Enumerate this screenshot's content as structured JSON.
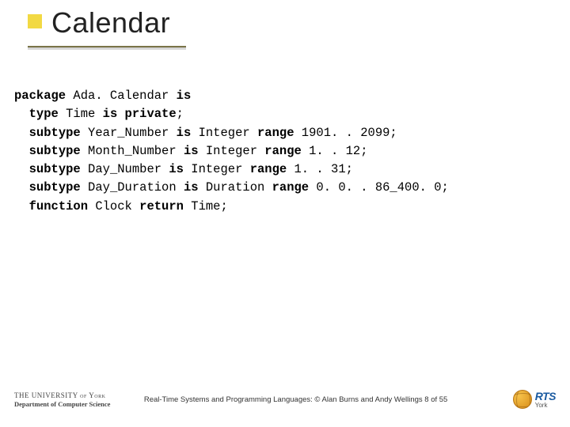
{
  "title": "Calendar",
  "code": {
    "lines": [
      {
        "segments": [
          {
            "t": "package",
            "kw": true
          },
          {
            "t": " Ada. Calendar "
          },
          {
            "t": "is",
            "kw": true
          }
        ]
      },
      {
        "segments": [
          {
            "t": "  "
          },
          {
            "t": "type",
            "kw": true
          },
          {
            "t": " Time "
          },
          {
            "t": "is private",
            "kw": true
          },
          {
            "t": ";"
          }
        ]
      },
      {
        "segments": [
          {
            "t": ""
          }
        ]
      },
      {
        "segments": [
          {
            "t": "  "
          },
          {
            "t": "subtype",
            "kw": true
          },
          {
            "t": " Year_Number "
          },
          {
            "t": "is",
            "kw": true
          },
          {
            "t": " Integer "
          },
          {
            "t": "range",
            "kw": true
          },
          {
            "t": " 1901. . 2099;"
          }
        ]
      },
      {
        "segments": [
          {
            "t": "  "
          },
          {
            "t": "subtype",
            "kw": true
          },
          {
            "t": " Month_Number "
          },
          {
            "t": "is",
            "kw": true
          },
          {
            "t": " Integer "
          },
          {
            "t": "range",
            "kw": true
          },
          {
            "t": " 1. . 12;"
          }
        ]
      },
      {
        "segments": [
          {
            "t": "  "
          },
          {
            "t": "subtype",
            "kw": true
          },
          {
            "t": " Day_Number "
          },
          {
            "t": "is",
            "kw": true
          },
          {
            "t": " Integer "
          },
          {
            "t": "range",
            "kw": true
          },
          {
            "t": " 1. . 31;"
          }
        ]
      },
      {
        "segments": [
          {
            "t": "  "
          },
          {
            "t": "subtype",
            "kw": true
          },
          {
            "t": " Day_Duration "
          },
          {
            "t": "is",
            "kw": true
          },
          {
            "t": " Duration "
          },
          {
            "t": "range",
            "kw": true
          },
          {
            "t": " 0. 0. . 86_400. 0;"
          }
        ]
      },
      {
        "segments": [
          {
            "t": ""
          }
        ]
      },
      {
        "segments": [
          {
            "t": "  "
          },
          {
            "t": "function",
            "kw": true
          },
          {
            "t": " Clock "
          },
          {
            "t": "return",
            "kw": true
          },
          {
            "t": " Time;"
          }
        ]
      }
    ]
  },
  "footer": {
    "university_line": "THE UNIVERSITY of York",
    "department_line": "Department of Computer Science",
    "center_text": "Real-Time Systems and Programming Languages: © Alan Burns and Andy Wellings  8 of 55",
    "rts": "RTS",
    "york": "York"
  }
}
